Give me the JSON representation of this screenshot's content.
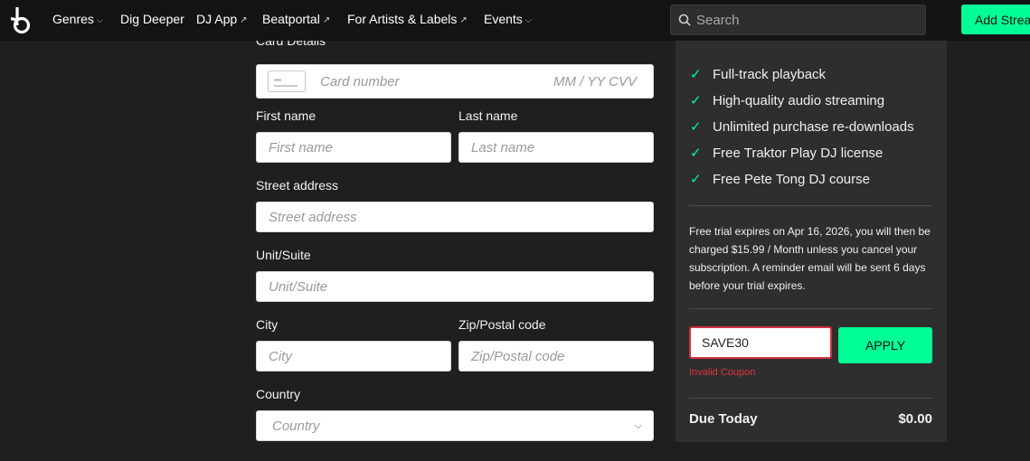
{
  "nav": {
    "items": [
      {
        "label": "Genres",
        "suffix": "⌵"
      },
      {
        "label": "Dig Deeper",
        "suffix": ""
      },
      {
        "label": "DJ App",
        "suffix": "↗"
      },
      {
        "label": "Beatportal",
        "suffix": "↗"
      },
      {
        "label": "For Artists & Labels",
        "suffix": "↗"
      },
      {
        "label": "Events",
        "suffix": "⌵"
      }
    ],
    "search_placeholder": "Search",
    "add_button": "Add Strea"
  },
  "form": {
    "card_section_label": "Card Details",
    "card_number_placeholder": "Card number",
    "card_expiry_cvv_placeholder": "MM / YY  CVV",
    "first_name_label": "First name",
    "first_name_placeholder": "First name",
    "last_name_label": "Last name",
    "last_name_placeholder": "Last name",
    "street_label": "Street address",
    "street_placeholder": "Street address",
    "unit_label": "Unit/Suite",
    "unit_placeholder": "Unit/Suite",
    "city_label": "City",
    "city_placeholder": "City",
    "zip_label": "Zip/Postal code",
    "zip_placeholder": "Zip/Postal code",
    "country_label": "Country",
    "country_placeholder": "Country"
  },
  "summary": {
    "features": [
      "Full-track playback",
      "High-quality audio streaming",
      "Unlimited purchase re-downloads",
      "Free Traktor Play DJ license",
      "Free Pete Tong DJ course"
    ],
    "trial_text": "Free trial expires on Apr 16, 2026, you will then be charged $15.99 / Month unless you cancel your subscription. A reminder email will be sent 6 days before your trial expires.",
    "coupon_value": "SAVE30",
    "apply_label": "APPLY",
    "coupon_error": "Invalid Coupon",
    "due_label": "Due Today",
    "due_value": "$0.00"
  },
  "colors": {
    "accent": "#01ff95",
    "error": "#e0313f",
    "panel": "#2e2e2e",
    "background": "#1f1f1f",
    "topbar": "#141414"
  }
}
